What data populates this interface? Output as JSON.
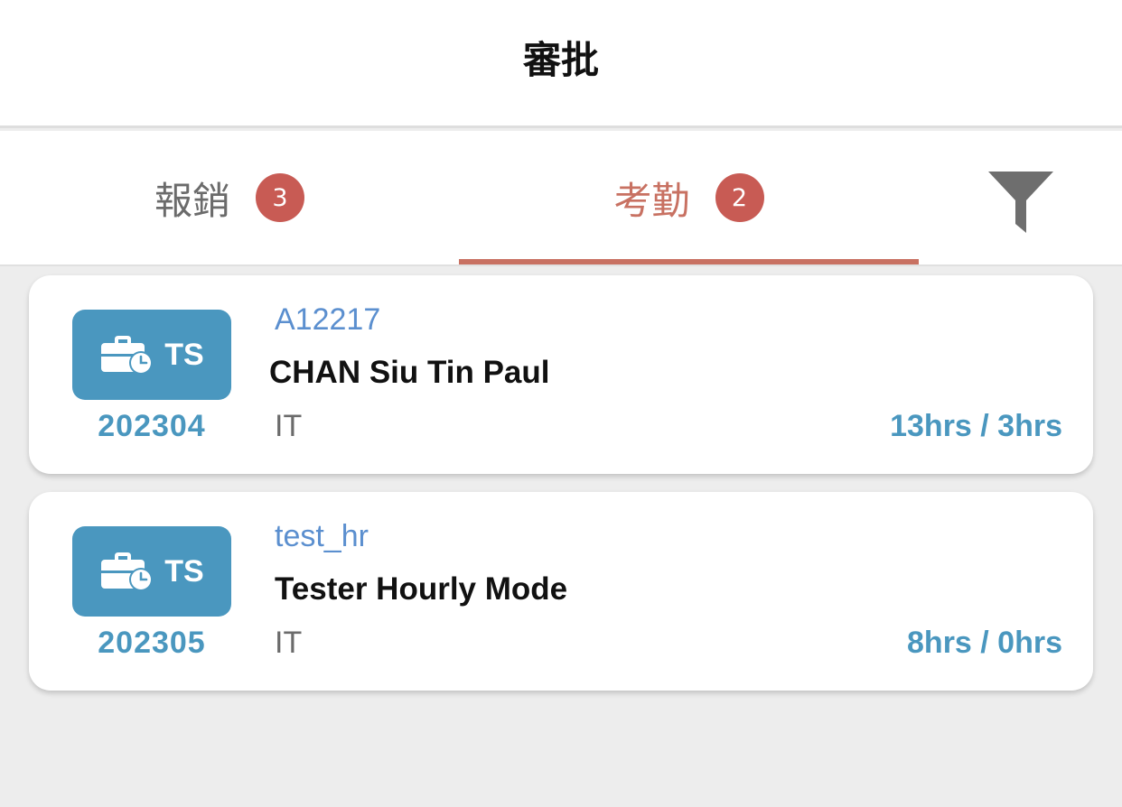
{
  "header": {
    "title": "審批"
  },
  "tabs": [
    {
      "label": "報銷",
      "badge": "3"
    },
    {
      "label": "考勤",
      "badge": "2"
    }
  ],
  "active_tab": "考勤",
  "filter": {
    "icon": "filter-icon"
  },
  "records": [
    {
      "type_label": "TS",
      "type_icon": "briefcase-clock-icon",
      "period": "202304",
      "emp_id": "A12217",
      "name": "CHAN Siu Tin Paul",
      "department": "IT",
      "hours": "13hrs / 3hrs"
    },
    {
      "type_label": "TS",
      "type_icon": "briefcase-clock-icon",
      "period": "202305",
      "emp_id": "test_hr",
      "name": "Tester Hourly Mode",
      "department": "IT",
      "hours": "8hrs / 0hrs"
    }
  ],
  "colors": {
    "accent": "#c87162",
    "badge": "#c85b54",
    "primary": "#4a97bf",
    "link": "#5b8fcf",
    "background": "#ededed"
  }
}
